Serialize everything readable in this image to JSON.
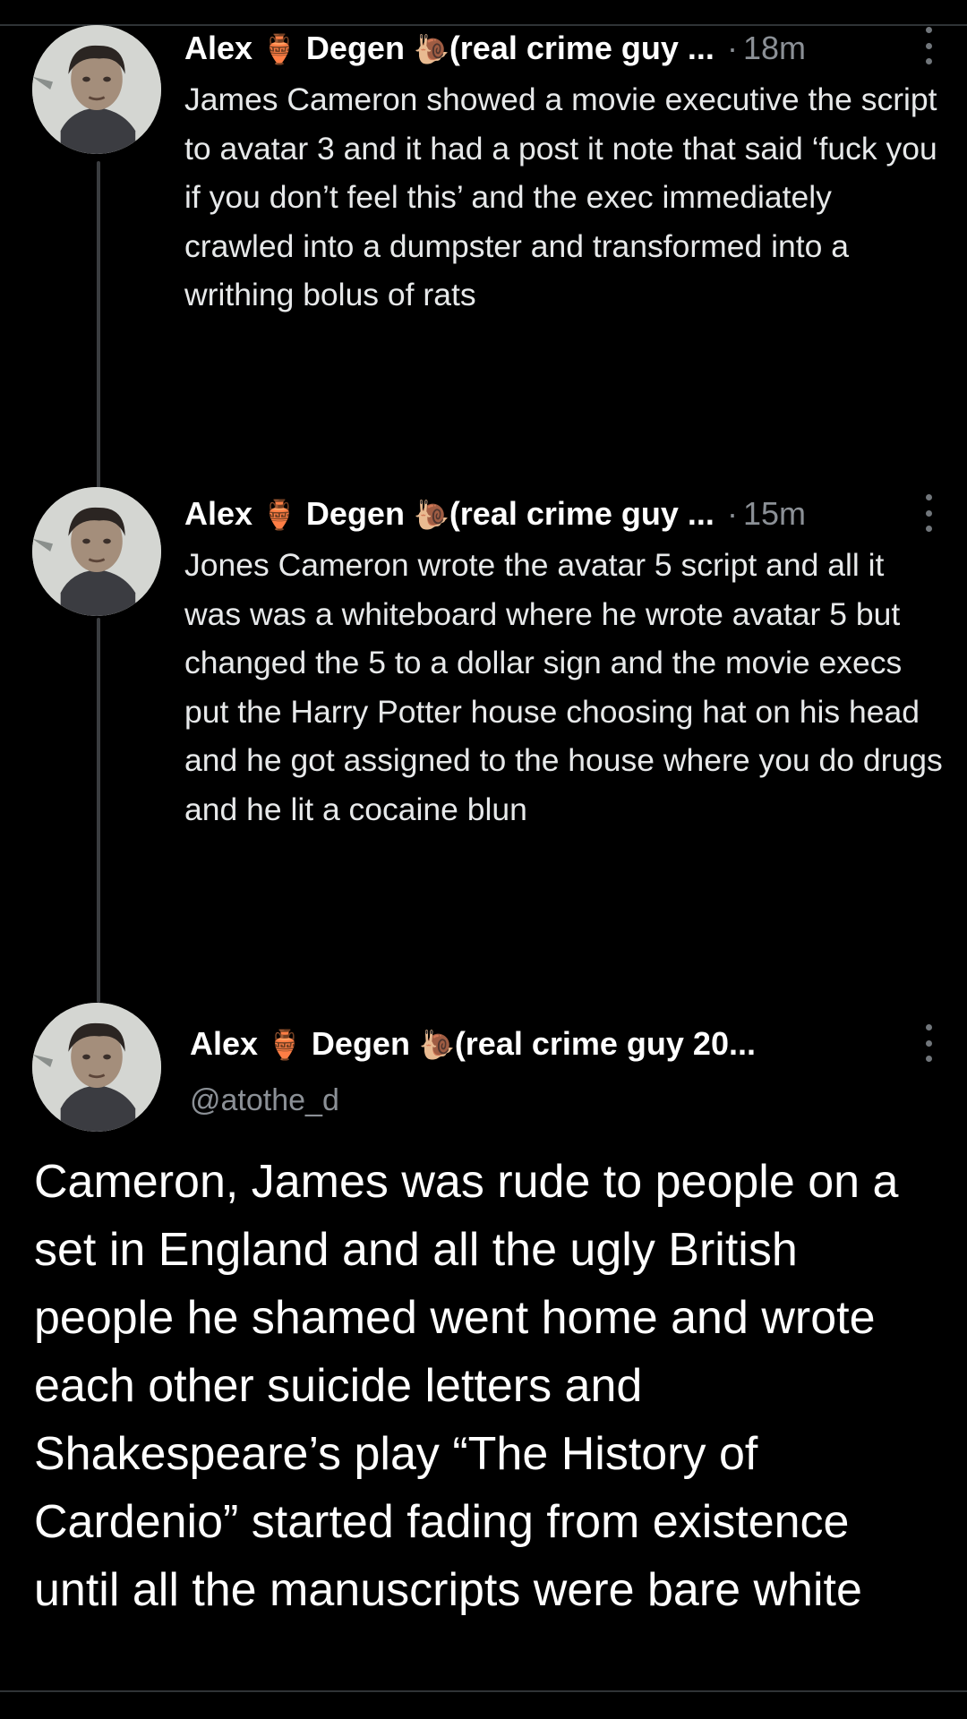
{
  "thread": [
    {
      "author_name": "Alex",
      "author_surname": "Degen",
      "author_emoji_1": "🏺",
      "author_emoji_2": "🐌",
      "author_suffix": "(real crime guy ...",
      "separator": "·",
      "timestamp": "18m",
      "text": "James Cameron showed a movie executive the script to avatar 3 and it had a post it note that said ‘fuck you if you don’t feel this’ and the exec immediately crawled into a dumpster and transformed into a writhing bolus of rats"
    },
    {
      "author_name": "Alex",
      "author_surname": "Degen",
      "author_emoji_1": "🏺",
      "author_emoji_2": "🐌",
      "author_suffix": "(real crime guy ...",
      "separator": "·",
      "timestamp": "15m",
      "text": "Jones Cameron wrote the avatar 5 script and all it was was a whiteboard where he wrote avatar 5 but changed the 5 to a dollar sign and the movie execs put the Harry Potter house choosing hat on his head and he got assigned to the house where you do drugs and he lit a cocaine blun"
    }
  ],
  "main_tweet": {
    "author_name": "Alex",
    "author_surname": "Degen",
    "author_emoji_1": "🏺",
    "author_emoji_2": "🐌",
    "author_suffix": "(real crime guy 20...",
    "handle": "@atothe_d",
    "text": "Cameron, James was rude to people on a set in England and all the ugly British people he shamed went home and wrote each other suicide letters and Shakespeare’s play “The History of Cardenio” started fading from existence until all the manuscripts were bare white"
  },
  "icons": {
    "avatar": "avatar-portrait",
    "more": "more-vertical-icon"
  },
  "colors": {
    "background": "#000000",
    "text": "#e7e9ea",
    "secondary_text": "#8b9096",
    "thread_line": "#3a3d40"
  }
}
